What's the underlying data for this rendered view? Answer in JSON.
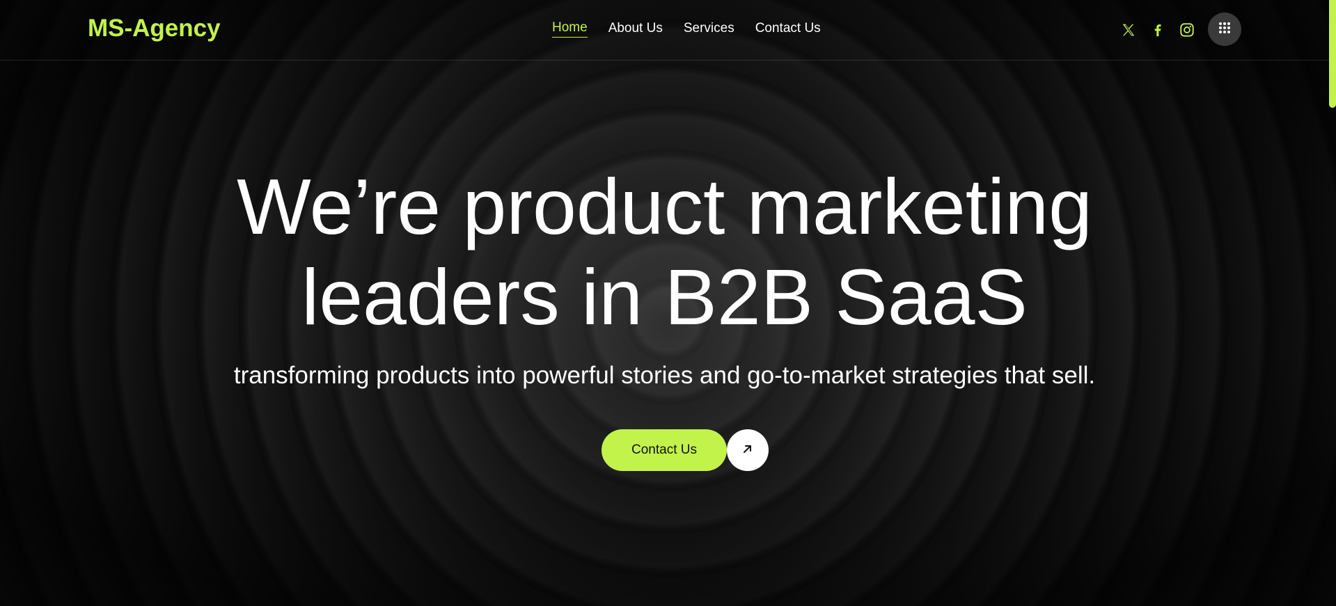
{
  "header": {
    "logo": "MS-Agency",
    "nav": [
      {
        "label": "Home",
        "active": true
      },
      {
        "label": "About Us",
        "active": false
      },
      {
        "label": "Services",
        "active": false
      },
      {
        "label": "Contact Us",
        "active": false
      }
    ],
    "social_icons": [
      "x-twitter-icon",
      "facebook-icon",
      "instagram-icon"
    ],
    "menu_icon": "grid-menu-icon"
  },
  "hero": {
    "title_line1": "We’re product marketing",
    "title_line2": "leaders in B2B SaaS",
    "subtitle": "transforming products into powerful stories and go-to-market strategies that sell.",
    "cta_label": "Contact Us",
    "cta_icon": "arrow-up-right-icon"
  },
  "colors": {
    "accent": "#c2f34a",
    "background": "#111111",
    "text": "#ffffff"
  }
}
